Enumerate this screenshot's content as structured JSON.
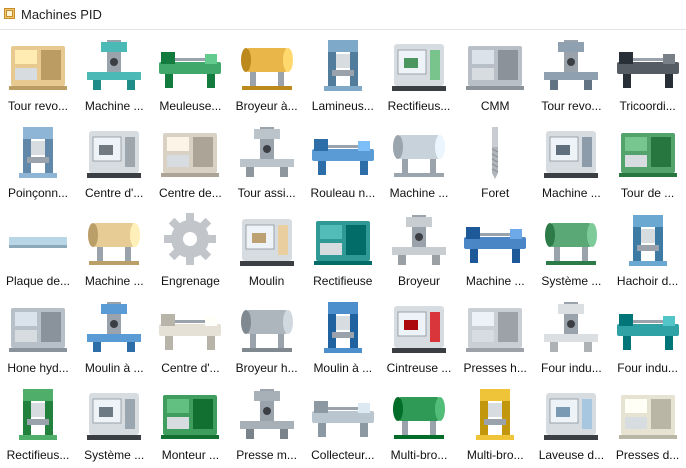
{
  "panel": {
    "title": "Machines PID",
    "icon": "library-shape-icon"
  },
  "items": [
    {
      "label": "Tour revo...",
      "icon": "turret-lathe-icon",
      "color": "#e8c98f"
    },
    {
      "label": "Machine ...",
      "icon": "extruder-machine-icon",
      "color": "#4bb9b5"
    },
    {
      "label": "Meuleuse...",
      "icon": "surface-grinder-icon",
      "color": "#3fa86a"
    },
    {
      "label": "Broyeur à...",
      "icon": "drum-crusher-icon",
      "color": "#e9b64a"
    },
    {
      "label": "Lamineus...",
      "icon": "rolling-mill-icon",
      "color": "#7fa9c8"
    },
    {
      "label": "Rectifieus...",
      "icon": "cylindrical-grinder-icon",
      "color": "#79c48d"
    },
    {
      "label": "CMM",
      "icon": "cmm-icon",
      "color": "#b8bfc6"
    },
    {
      "label": "Tour revo...",
      "icon": "cnc-turret-icon",
      "color": "#8fa1b1"
    },
    {
      "label": "Tricoordi...",
      "icon": "tri-coordinate-icon",
      "color": "#555c63"
    },
    {
      "label": "Poinçonn...",
      "icon": "punch-press-icon",
      "color": "#8fb5d6"
    },
    {
      "label": "Centre d'...",
      "icon": "drill-center-icon",
      "color": "#9fa7ae"
    },
    {
      "label": "Centre de...",
      "icon": "machining-center-icon",
      "color": "#d9d2c4"
    },
    {
      "label": "Tour assi...",
      "icon": "assisted-lathe-icon",
      "color": "#bcc4cb"
    },
    {
      "label": "Rouleau n...",
      "icon": "roller-icon",
      "color": "#5b9bd5"
    },
    {
      "label": "Machine ...",
      "icon": "bench-machine-icon",
      "color": "#c7d2da"
    },
    {
      "label": "Foret",
      "icon": "drill-bit-icon",
      "color": "#a8adb2"
    },
    {
      "label": "Machine ...",
      "icon": "spindle-machine-icon",
      "color": "#8c9cab"
    },
    {
      "label": "Tour de ...",
      "icon": "small-lathe-icon",
      "color": "#55a36c"
    },
    {
      "label": "Plaque de...",
      "icon": "plate-icon",
      "color": "#b9d6e6"
    },
    {
      "label": "Machine ...",
      "icon": "box-machine-icon",
      "color": "#e7cc95"
    },
    {
      "label": "Engrenage",
      "icon": "gear-icon",
      "color": "#c2c6ca"
    },
    {
      "label": "Moulin",
      "icon": "mill-icon",
      "color": "#e9cfa0"
    },
    {
      "label": "Rectifieuse",
      "icon": "cabinet-grinder-icon",
      "color": "#2f9a95"
    },
    {
      "label": "Broyeur",
      "icon": "crusher-icon",
      "color": "#c8cdd2"
    },
    {
      "label": "Machine ...",
      "icon": "face-machine-icon",
      "color": "#4a86c5"
    },
    {
      "label": "Système ...",
      "icon": "rail-system-icon",
      "color": "#5aa876"
    },
    {
      "label": "Hachoir d...",
      "icon": "chopper-icon",
      "color": "#6aa7d1"
    },
    {
      "label": "Hone hyd...",
      "icon": "hydraulic-hone-icon",
      "color": "#b7c0c8"
    },
    {
      "label": "Moulin à ...",
      "icon": "table-mill-icon",
      "color": "#5b9bd5"
    },
    {
      "label": "Centre d'...",
      "icon": "enclosure-center-icon",
      "color": "#e5e1d6"
    },
    {
      "label": "Broyeur h...",
      "icon": "horizontal-crusher-icon",
      "color": "#aeb6bd"
    },
    {
      "label": "Moulin à ...",
      "icon": "knee-mill-icon",
      "color": "#4c8fcc"
    },
    {
      "label": "Cintreuse ...",
      "icon": "press-brake-icon",
      "color": "#d8363a"
    },
    {
      "label": "Presses h...",
      "icon": "hydraulic-press-icon",
      "color": "#c9cfd4"
    },
    {
      "label": "Four indu...",
      "icon": "industrial-oven-icon",
      "color": "#dcdfe2"
    },
    {
      "label": "Four indu...",
      "icon": "industrial-furnace-icon",
      "color": "#2fa2a6"
    },
    {
      "label": "Rectifieus...",
      "icon": "green-grinder-icon",
      "color": "#4fae6a"
    },
    {
      "label": "Système ...",
      "icon": "tower-system-icon",
      "color": "#9aa6b0"
    },
    {
      "label": "Monteur ...",
      "icon": "assembler-icon",
      "color": "#3f9e5e"
    },
    {
      "label": "Presse m...",
      "icon": "mechanical-press-icon",
      "color": "#a8b0b7"
    },
    {
      "label": "Collecteur...",
      "icon": "collector-icon",
      "color": "#b9c5cf"
    },
    {
      "label": "Multi-bro...",
      "icon": "multi-spindle-green-icon",
      "color": "#2f9a55"
    },
    {
      "label": "Multi-bro...",
      "icon": "multi-spindle-yellow-icon",
      "color": "#f0c438"
    },
    {
      "label": "Laveuse d...",
      "icon": "washer-icon",
      "color": "#a7c6e0"
    },
    {
      "label": "Presses d...",
      "icon": "column-press-icon",
      "color": "#e7e3d2"
    }
  ]
}
